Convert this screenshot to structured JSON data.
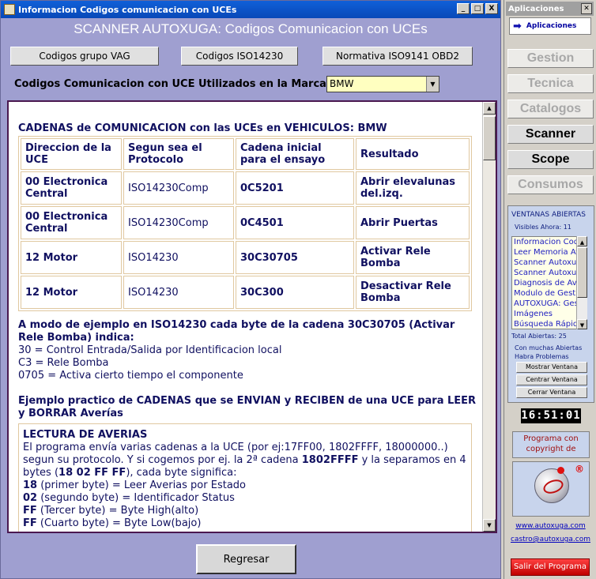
{
  "window": {
    "title": "Informacion Codigos comunicacion con UCEs",
    "min_label": "_",
    "max_label": "□",
    "close_label": "X"
  },
  "header": {
    "title": "SCANNER AUTOXUGA: Codigos Comunicacion con UCEs"
  },
  "toolbar": {
    "btn1": "Codigos grupo VAG",
    "btn2": "Codigos ISO14230",
    "btn3": "Normativa ISO9141 OBD2"
  },
  "marca": {
    "label": "Codigos Comunicacion con UCE Utilizados en la Marca",
    "value": "BMW"
  },
  "content": {
    "heading": "CADENAS de COMUNICACION con las UCEs en VEHICULOS: BMW",
    "table": {
      "headers": [
        "Direccion de la UCE",
        "Segun sea el Protocolo",
        "Cadena inicial para el ensayo",
        "Resultado"
      ],
      "rows": [
        [
          "00 Electronica Central",
          "ISO14230Comp",
          "0C5201",
          "Abrir elevalunas del.izq."
        ],
        [
          "00 Electronica Central",
          "ISO14230Comp",
          "0C4501",
          "Abrir Puertas"
        ],
        [
          "12 Motor",
          "ISO14230",
          "30C30705",
          "Activar Rele Bomba"
        ],
        [
          "12 Motor",
          "ISO14230",
          "30C300",
          "Desactivar Rele Bomba"
        ]
      ]
    },
    "example_heading": "A modo de ejemplo en ISO14230 cada byte de la cadena 30C30705 (Activar Rele Bomba) indica:",
    "example_lines": [
      "30 = Control Entrada/Salida por Identificacion local",
      "C3 = Rele Bomba",
      "0705 = Activa cierto tiempo el componente"
    ],
    "practical_heading": "Ejemplo practico de CADENAS que se ENVIAN y RECIBEN de una UCE para LEER y BORRAR Averías",
    "box": {
      "title": "LECTURA DE AVERIAS",
      "p1": "El programa envía varias cadenas a la UCE (por ej:17FF00, 1802FFFF, 18000000..) segun su protocolo. Y si cogemos por ej. la 2ª cadena ",
      "p1_bold": "1802FFFF",
      "p1_end": " y la separamos en 4 bytes (",
      "p1_bytes": "18 02 FF FF",
      "p1_tail": "), cada byte significa:",
      "bytes": [
        {
          "k": "18",
          "v": " (primer byte) = Leer Averias por Estado"
        },
        {
          "k": "02",
          "v": " (segundo byte) = Identificador Status"
        },
        {
          "k": "FF",
          "v": " (Tercer byte) = Byte High(alto)"
        },
        {
          "k": "FF",
          "v": " (Cuarto byte) = Byte Low(bajo)"
        }
      ]
    }
  },
  "footer": {
    "back": "Regresar"
  },
  "side": {
    "title": "Aplicaciones",
    "apps_btn": "Aplicaciones",
    "nav": [
      "Gestion",
      "Tecnica",
      "Catalogos",
      "Scanner",
      "Scope",
      "Consumos"
    ],
    "ventanas_title": "VENTANAS ABIERTAS",
    "visibles": "Visibles Ahora: 11",
    "windows": [
      "Informacion Codigos",
      "Leer Memoria Averias",
      "Scanner Autoxuga",
      "Scanner Autoxuga",
      "Diagnosis de Averias",
      "Modulo de Gestion",
      "AUTOXUGA: Gestion",
      "Imágenes",
      "Búsqueda Rápida"
    ],
    "total": "Total Abiertas: 25",
    "warning": "Con muchas Abiertas Habra Problemas",
    "btn_mostrar": "Mostrar Ventana",
    "btn_centrar": "Centrar Ventana",
    "btn_cerrar": "Cerrar Ventana",
    "clock": "16:51:01",
    "copyright": "Programa con copyright de",
    "web": "www.autoxuga.com",
    "email": "castro@autoxuga.com",
    "exit": "Salir del Programa"
  }
}
